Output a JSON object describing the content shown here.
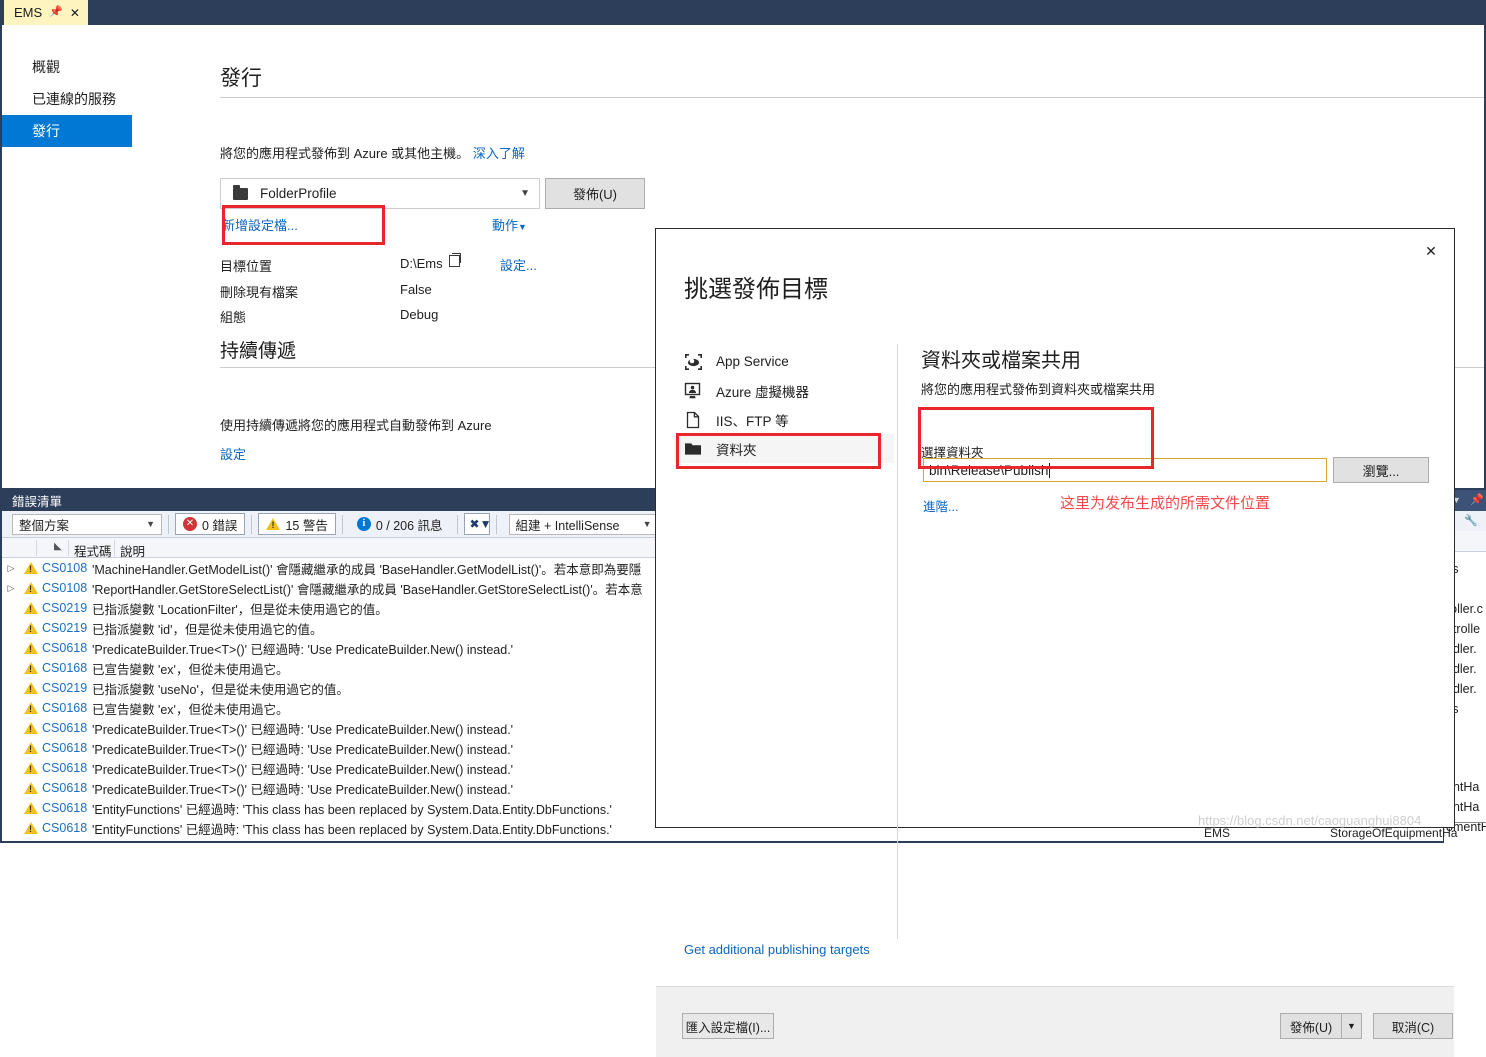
{
  "window": {
    "tab": {
      "label": "EMS",
      "pin_icon": "pin-icon",
      "close_icon": "close-icon"
    }
  },
  "publish_page": {
    "nav": [
      {
        "label": "概觀",
        "selected": false
      },
      {
        "label": "已連線的服務",
        "selected": false
      },
      {
        "label": "發行",
        "selected": true
      }
    ],
    "title": "發行",
    "subtitle": "將您的應用程式發佈到 Azure 或其他主機。",
    "learn_more": "深入了解",
    "profile": {
      "name": "FolderProfile",
      "icon": "folder-icon"
    },
    "publish_button": "發佈(U)",
    "new_profile_link": "新增設定檔...",
    "actions_link": "動作",
    "properties": [
      {
        "label": "目標位置",
        "value": "D:\\Ems",
        "has_copy": true,
        "action": "設定..."
      },
      {
        "label": "刪除現有檔案",
        "value": "False",
        "has_copy": false,
        "action": ""
      },
      {
        "label": "組態",
        "value": "Debug",
        "has_copy": false,
        "action": ""
      }
    ],
    "continuous_delivery": {
      "title": "持續傳遞",
      "description": "使用持續傳遞將您的應用程式自動發佈到 Azure",
      "setup_link": "設定"
    }
  },
  "dialog": {
    "title": "挑選發佈目標",
    "close_icon": "close-icon",
    "targets": [
      {
        "label": "App Service",
        "icon": "app-service-icon",
        "selected": false
      },
      {
        "label": "Azure 虛擬機器",
        "icon": "azure-vm-icon",
        "selected": false
      },
      {
        "label": "IIS、FTP 等",
        "icon": "file-icon",
        "selected": false
      },
      {
        "label": "資料夾",
        "icon": "folder-icon",
        "selected": true
      }
    ],
    "detail": {
      "title": "資料夾或檔案共用",
      "subtitle": "將您的應用程式發佈到資料夾或檔案共用",
      "field_label": "選擇資料夾",
      "field_value": "bin\\Release\\Publish",
      "browse_button": "瀏覽...",
      "advanced_link": "進階..."
    },
    "additional_targets_link": "Get additional publishing targets",
    "footer": {
      "import_button": "匯入設定檔(I)...",
      "publish_button": "發佈(U)",
      "publish_split_icon": "chevron-down-icon",
      "cancel_button": "取消(C)"
    }
  },
  "annotations": {
    "note_text": "这里为发布生成的所需文件位置",
    "highlight_color": "#e8262b",
    "note_color": "#f24a4a"
  },
  "error_list": {
    "panel_title": "錯誤清單",
    "scope_filter": "整個方案",
    "counters": [
      {
        "icon": "error-icon",
        "label": "0 錯誤",
        "active": true
      },
      {
        "icon": "warning-icon",
        "label": "15 警告",
        "active": true
      },
      {
        "icon": "info-icon",
        "label": "0 / 206 訊息",
        "active": false
      }
    ],
    "filter_icon": "clear-filter-icon",
    "build_filter": "組建 + IntelliSense",
    "columns": [
      "",
      "程式碼",
      "說明"
    ],
    "rows": [
      {
        "expandable": true,
        "severity": "warning",
        "code": "CS0108",
        "description": "'MachineHandler.GetModelList()' 會隱藏繼承的成員 'BaseHandler.GetModelList()'。若本意即為要隱"
      },
      {
        "expandable": true,
        "severity": "warning",
        "code": "CS0108",
        "description": "'ReportHandler.GetStoreSelectList()' 會隱藏繼承的成員 'BaseHandler.GetStoreSelectList()'。若本意"
      },
      {
        "expandable": false,
        "severity": "warning",
        "code": "CS0219",
        "description": "已指派變數 'LocationFilter'，但是從未使用過它的值。"
      },
      {
        "expandable": false,
        "severity": "warning",
        "code": "CS0219",
        "description": "已指派變數 'id'，但是從未使用過它的值。"
      },
      {
        "expandable": false,
        "severity": "warning",
        "code": "CS0618",
        "description": "'PredicateBuilder.True<T>()' 已經過時: 'Use PredicateBuilder.New() instead.'"
      },
      {
        "expandable": false,
        "severity": "warning",
        "code": "CS0168",
        "description": "已宣告變數 'ex'，但從未使用過它。"
      },
      {
        "expandable": false,
        "severity": "warning",
        "code": "CS0219",
        "description": "已指派變數 'useNo'，但是從未使用過它的值。"
      },
      {
        "expandable": false,
        "severity": "warning",
        "code": "CS0168",
        "description": "已宣告變數 'ex'，但從未使用過它。"
      },
      {
        "expandable": false,
        "severity": "warning",
        "code": "CS0618",
        "description": "'PredicateBuilder.True<T>()' 已經過時: 'Use PredicateBuilder.New() instead.'"
      },
      {
        "expandable": false,
        "severity": "warning",
        "code": "CS0618",
        "description": "'PredicateBuilder.True<T>()' 已經過時: 'Use PredicateBuilder.New() instead.'"
      },
      {
        "expandable": false,
        "severity": "warning",
        "code": "CS0618",
        "description": "'PredicateBuilder.True<T>()' 已經過時: 'Use PredicateBuilder.New() instead.'"
      },
      {
        "expandable": false,
        "severity": "warning",
        "code": "CS0618",
        "description": "'PredicateBuilder.True<T>()' 已經過時: 'Use PredicateBuilder.New() instead.'"
      },
      {
        "expandable": false,
        "severity": "warning",
        "code": "CS0618",
        "description": "'EntityFunctions' 已經過時: 'This class has been replaced by System.Data.Entity.DbFunctions.'"
      },
      {
        "expandable": false,
        "severity": "warning",
        "code": "CS0618",
        "description": "'EntityFunctions' 已經過時: 'This class has been replaced by System.Data.Entity.DbFunctions.'"
      }
    ]
  },
  "right_panel": {
    "caret_icon": "chevron-down-icon",
    "pin_icon": "pin-icon",
    "tool_icon": "wrench-icon",
    "clipped_rows": [
      "cs",
      "roller.c",
      "ntrolle",
      "ndler.",
      "ndler.",
      "ndler.",
      "cs",
      "entHa",
      "entHa",
      "omentHa"
    ]
  },
  "status_bar": {
    "project": "EMS",
    "file": "StorageOfEquipmentHa"
  },
  "watermark": "https://blog.csdn.net/caoguanghui8804"
}
